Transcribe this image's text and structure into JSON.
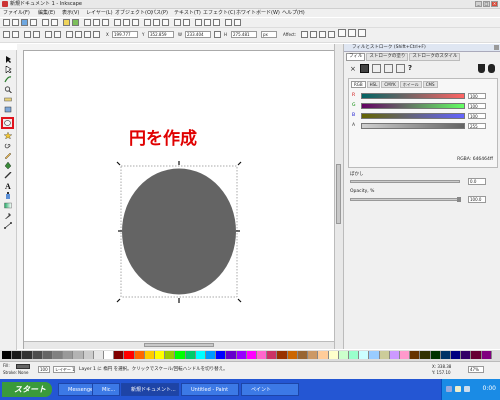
{
  "window": {
    "title": "新規ドキュメント 1 - Inkscape"
  },
  "menu": [
    "ファイル(F)",
    "編集(E)",
    "表示(V)",
    "レイヤー(L)",
    "オブジェクト(O)",
    "パス(P)",
    "テキスト(T)",
    "エフェクト(C)",
    "ホワイトボード(W)",
    "ヘルプ(H)"
  ],
  "toolbar": {
    "x_label": "X",
    "x_value": "199.777",
    "y_label": "Y",
    "y_value": "352.859",
    "w_label": "W",
    "w_value": "233.404",
    "h_label": "H",
    "h_value": "275.481",
    "unit": "px",
    "affect_label": "Affect:"
  },
  "canvas": {
    "heading": "円を作成",
    "ellipse_color": "#646464",
    "heading_color": "#e00000"
  },
  "panel": {
    "title": "フィルとストローク (Shift+Ctrl+F)",
    "tabs": [
      "フィル",
      "ストロークの塗り",
      "ストロークのスタイル"
    ],
    "mode_tabs": [
      "RGB",
      "HSL",
      "CMYK",
      "ホイール",
      "CMS"
    ],
    "channels": [
      {
        "label": "R",
        "value": "100"
      },
      {
        "label": "G",
        "value": "100"
      },
      {
        "label": "B",
        "value": "100"
      },
      {
        "label": "A",
        "value": "255"
      }
    ],
    "rgba": "RGBA: 646464ff",
    "blur_label": "ぼかし",
    "blur_value": "0.0",
    "opacity_label": "Opacity, %",
    "opacity_value": "100.0"
  },
  "status": {
    "fill_label": "Fill:",
    "stroke_label": "Stroke:",
    "stroke_value": "None",
    "opacity_value": "100",
    "layer_value": "レイヤー 1",
    "message": "Layer 1 に 楕円 を選択。クリックでスケール/回転ハンドルを切り替え。",
    "cursor_x": "X: 338.38",
    "cursor_y": "Y: 157.10",
    "zoom": "47%"
  },
  "taskbar": {
    "start": "スタート",
    "items": [
      "Messenger",
      "Mic...",
      "新規ドキュメント...",
      "Untitled - Paint",
      "ペイント"
    ],
    "clock": "0:00"
  },
  "palette": [
    "#000000",
    "#1a1a1a",
    "#333333",
    "#4d4d4d",
    "#666666",
    "#808080",
    "#999999",
    "#b3b3b3",
    "#cccccc",
    "#e6e6e6",
    "#ffffff",
    "#800000",
    "#ff0000",
    "#ff6600",
    "#ffcc00",
    "#ffff00",
    "#99cc00",
    "#00ff00",
    "#00cc66",
    "#00ffff",
    "#0099ff",
    "#0000ff",
    "#6600cc",
    "#9900ff",
    "#ff00ff",
    "#ff66cc",
    "#cc3366",
    "#993300",
    "#cc6600",
    "#996633",
    "#cc9966",
    "#ffcc99",
    "#ffffcc",
    "#ccffcc",
    "#99ffcc",
    "#ccffff",
    "#99ccff",
    "#cccc99",
    "#cc99ff",
    "#ff99cc",
    "#663300",
    "#333300",
    "#003300",
    "#003366",
    "#000080",
    "#330066",
    "#660033",
    "#800080"
  ]
}
